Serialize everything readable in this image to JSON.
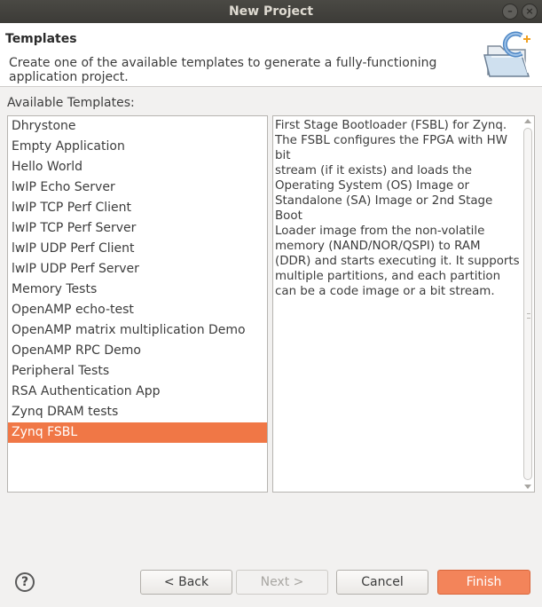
{
  "window": {
    "title": "New Project"
  },
  "header": {
    "title": "Templates",
    "description": "Create one of the available templates to generate a fully-functioning application project."
  },
  "templates": {
    "label": "Available Templates:",
    "items": [
      "Dhrystone",
      "Empty Application",
      "Hello World",
      "lwIP Echo Server",
      "lwIP TCP Perf Client",
      "lwIP TCP Perf Server",
      "lwIP UDP Perf Client",
      "lwIP UDP Perf Server",
      "Memory Tests",
      "OpenAMP echo-test",
      "OpenAMP matrix multiplication Demo",
      "OpenAMP RPC Demo",
      "Peripheral Tests",
      "RSA Authentication App",
      "Zynq DRAM tests",
      "Zynq FSBL"
    ],
    "selected": "Zynq FSBL",
    "description": "First Stage Bootloader (FSBL) for Zynq.\nThe FSBL configures the FPGA with HW bit\nstream (if it exists)  and loads the\nOperating System (OS) Image or\nStandalone (SA) Image or 2nd Stage Boot\nLoader image from the  non-volatile\nmemory (NAND/NOR/QSPI) to RAM\n(DDR) and starts executing it.  It supports\nmultiple partitions,  and each partition\ncan be a code image or a bit stream."
  },
  "buttons": {
    "help": "?",
    "back": "< Back",
    "next": "Next >",
    "cancel": "Cancel",
    "finish": "Finish"
  },
  "colors": {
    "accent": "#f07746",
    "titlebar": "#3c3b37"
  },
  "icons": {
    "wizard": "new-c-project-folder-icon",
    "help": "help-icon"
  }
}
